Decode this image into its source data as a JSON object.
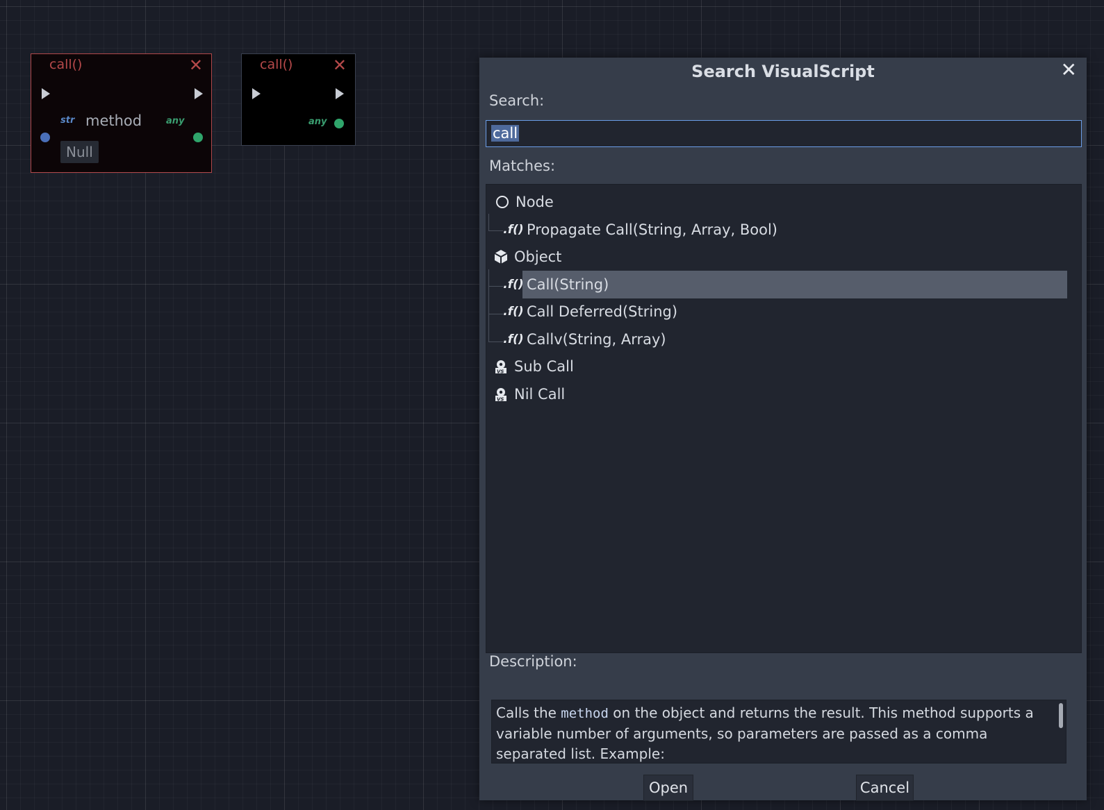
{
  "nodes": [
    {
      "title": "call()",
      "close": "✕",
      "in_port_type": "str",
      "in_label": "method",
      "out_port_type": "any",
      "default_value": "Null"
    },
    {
      "title": "call()",
      "close": "✕",
      "out_port_type": "any"
    }
  ],
  "dialog": {
    "title": "Search VisualScript",
    "close": "✕",
    "search_label": "Search:",
    "search_value": "call",
    "matches_label": "Matches:",
    "tree": [
      {
        "label": "Node",
        "icon": "node-circle-icon",
        "level": 0
      },
      {
        "label": "Propagate Call(String, Array, Bool)",
        "icon": ".f()",
        "level": 1
      },
      {
        "label": "Object",
        "icon": "object-cube-icon",
        "level": 0
      },
      {
        "label": "Call(String)",
        "icon": ".f()",
        "level": 1,
        "selected": true
      },
      {
        "label": "Call Deferred(String)",
        "icon": ".f()",
        "level": 1
      },
      {
        "label": "Callv(String, Array)",
        "icon": ".f()",
        "level": 1
      },
      {
        "label": "Sub Call",
        "icon": "visualscript-icon",
        "level": 0
      },
      {
        "label": "Nil Call",
        "icon": "visualscript-icon",
        "level": 0
      }
    ],
    "description_label": "Description:",
    "description_pre": "Calls the ",
    "description_code": "method",
    "description_post": " on the object and returns the result. This method supports a variable number of arguments, so parameters are passed as a comma separated list. Example:",
    "open_label": "Open",
    "cancel_label": "Cancel"
  },
  "colors": {
    "accent": "#6b9ee8",
    "node_selected_border": "#b0474a",
    "port_str": "#4a6fb8",
    "port_any": "#2fa56b"
  }
}
